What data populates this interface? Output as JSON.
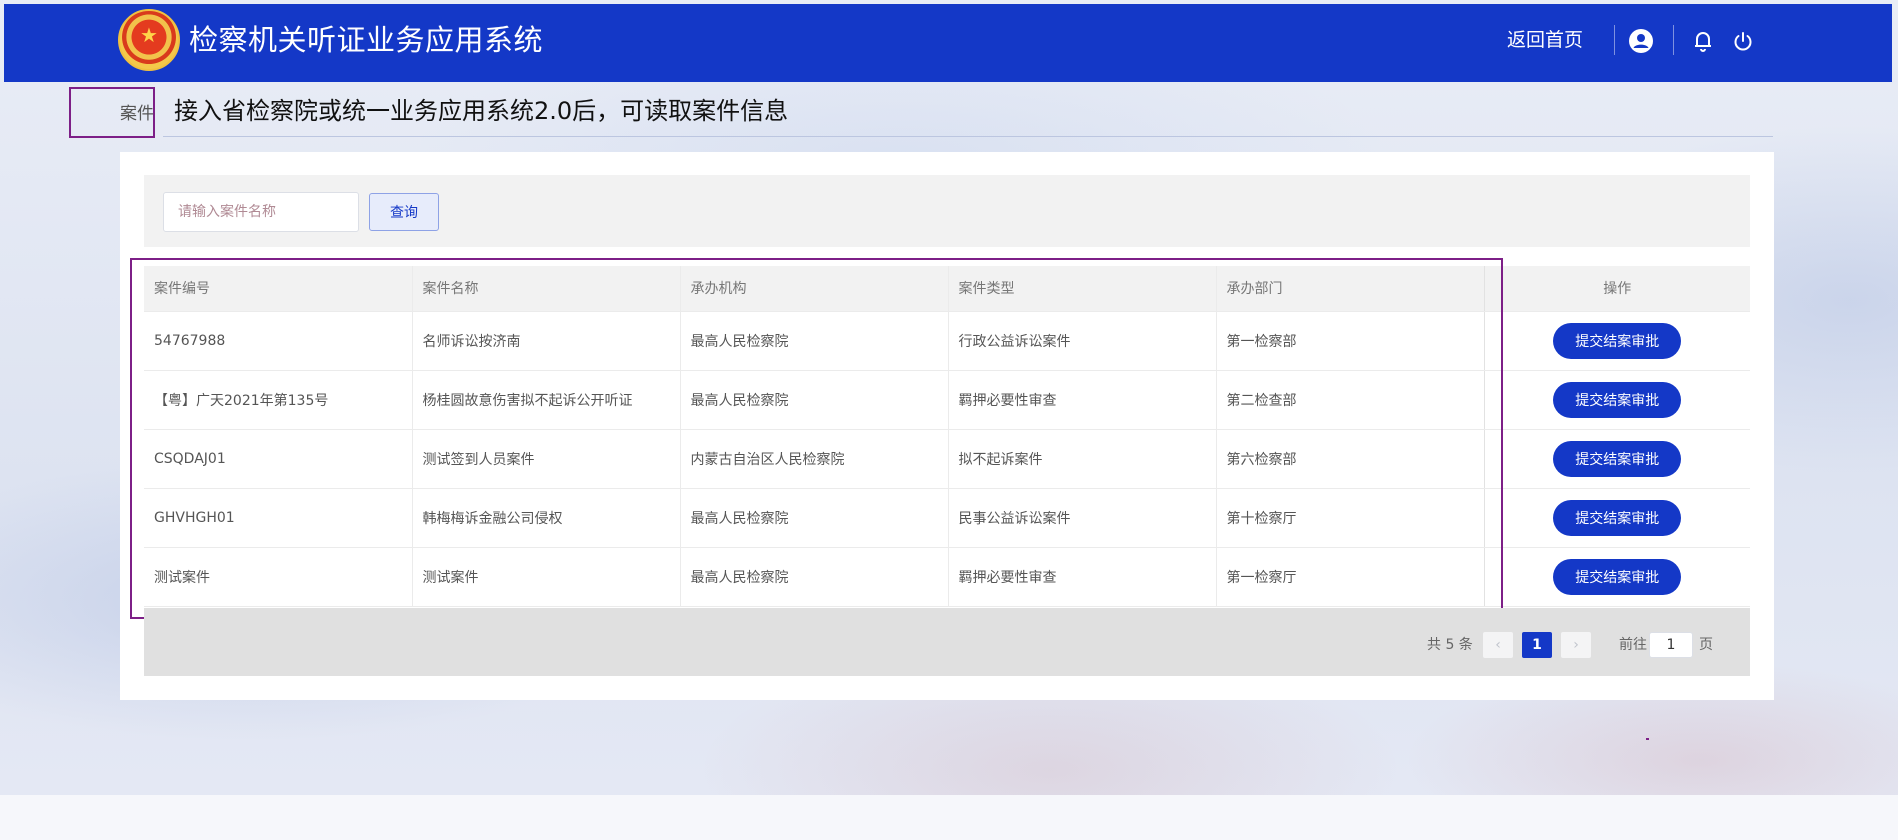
{
  "header": {
    "title": "检察机关听证业务应用系统",
    "home_link": "返回首页",
    "emblem_glyph": "★",
    "icons": [
      "user-icon",
      "bell-icon",
      "power-icon"
    ],
    "accent_color": "#1438c7"
  },
  "banner": {
    "tab_label": "案件",
    "text": "接入省检察院或统一业务应用系统2.0后，可读取案件信息"
  },
  "search": {
    "placeholder": "请输入案件名称",
    "value": "",
    "button_label": "查询"
  },
  "table": {
    "columns": [
      "案件编号",
      "案件名称",
      "承办机构",
      "案件类型",
      "承办部门",
      "操作"
    ],
    "rows": [
      {
        "id": "54767988",
        "name": "名师诉讼按济南",
        "org": "最高人民检察院",
        "type": "行政公益诉讼案件",
        "dept": "第一检察部",
        "action": "提交结案审批"
      },
      {
        "id": "【粤】广天2021年第135号",
        "name": "杨桂圆故意伤害拟不起诉公开听证",
        "org": "最高人民检察院",
        "type": "羁押必要性审查",
        "dept": "第二检查部",
        "action": "提交结案审批"
      },
      {
        "id": "CSQDAJ01",
        "name": "测试签到人员案件",
        "org": "内蒙古自治区人民检察院",
        "type": "拟不起诉案件",
        "dept": "第六检察部",
        "action": "提交结案审批"
      },
      {
        "id": "GHVHGH01",
        "name": "韩梅梅诉金融公司侵权",
        "org": "最高人民检察院",
        "type": "民事公益诉讼案件",
        "dept": "第十检察厅",
        "action": "提交结案审批"
      },
      {
        "id": "测试案件",
        "name": "测试案件",
        "org": "最高人民检察院",
        "type": "羁押必要性审查",
        "dept": "第一检察厅",
        "action": "提交结案审批"
      }
    ]
  },
  "pagination": {
    "total": "共 5 条",
    "prev": "‹",
    "next": "›",
    "current_page": "1",
    "goto_label": "前往",
    "goto_value": "1",
    "page_suffix": "页"
  }
}
